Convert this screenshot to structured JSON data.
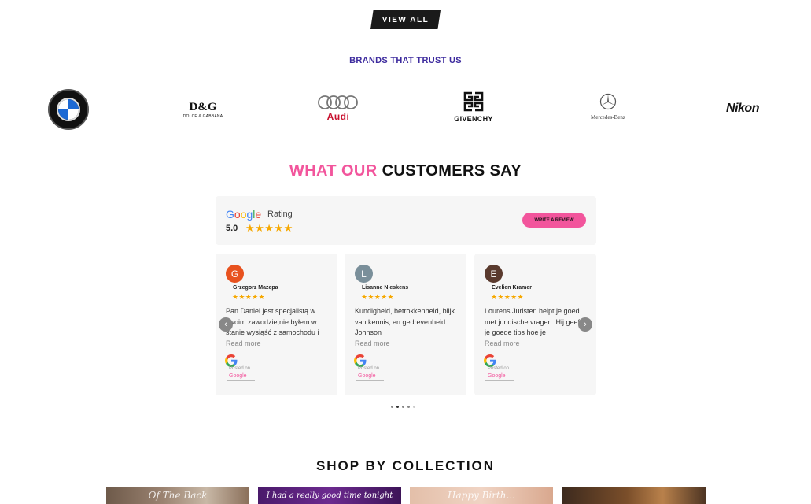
{
  "top": {
    "view_all_label": "VIEW ALL"
  },
  "brands": {
    "title": "BRANDS THAT TRUST US",
    "logos": {
      "bmw": "BMW",
      "dg_main": "D&G",
      "dg_sub": "DOLCE & GABBANA",
      "audi": "Audi",
      "givenchy": "GIVENCHY",
      "mercedes": "Mercedes-Benz",
      "nikon": "Nikon"
    }
  },
  "customers": {
    "title_pink": "WHAT OUR",
    "title_dark": "CUSTOMERS SAY",
    "rating_box": {
      "google": "Google",
      "rating_label": "Rating",
      "value": "5.0",
      "stars": "★★★★★",
      "write_review": "WRITE A REVIEW"
    },
    "reviews": [
      {
        "initial": "G",
        "color": "#e8521f",
        "name": "Grzegorz Mazepa",
        "stars": "★★★★★",
        "text": "Pan Daniel jest specjalistą w swoim zawodzie,nie byłem w stanie wysiąść z samochodu i",
        "more": "Read more",
        "posted": "Posted on",
        "source": "Google"
      },
      {
        "initial": "L",
        "color": "#7a8f9a",
        "name": "Lisanne Nieskens",
        "stars": "★★★★★",
        "text": "Kundigheid, betrokkenheid, blijk van kennis, en gedrevenheid. Johnson",
        "more": "Read more",
        "posted": "Posted on",
        "source": "Google"
      },
      {
        "initial": "E",
        "color": "#5a3a2e",
        "name": "Evelien Kramer",
        "stars": "★★★★★",
        "text": "Lourens Juristen helpt je goed met juridische vragen. Hij geeft je goede tips hoe je",
        "more": "Read more",
        "posted": "Posted on",
        "source": "Google"
      }
    ],
    "prev_arrow": "‹",
    "next_arrow": "›"
  },
  "collection": {
    "title": "SHOP BY COLLECTION",
    "items": [
      "Of The Back",
      "I had a really good time tonight",
      "Happy Birth...",
      ""
    ]
  }
}
